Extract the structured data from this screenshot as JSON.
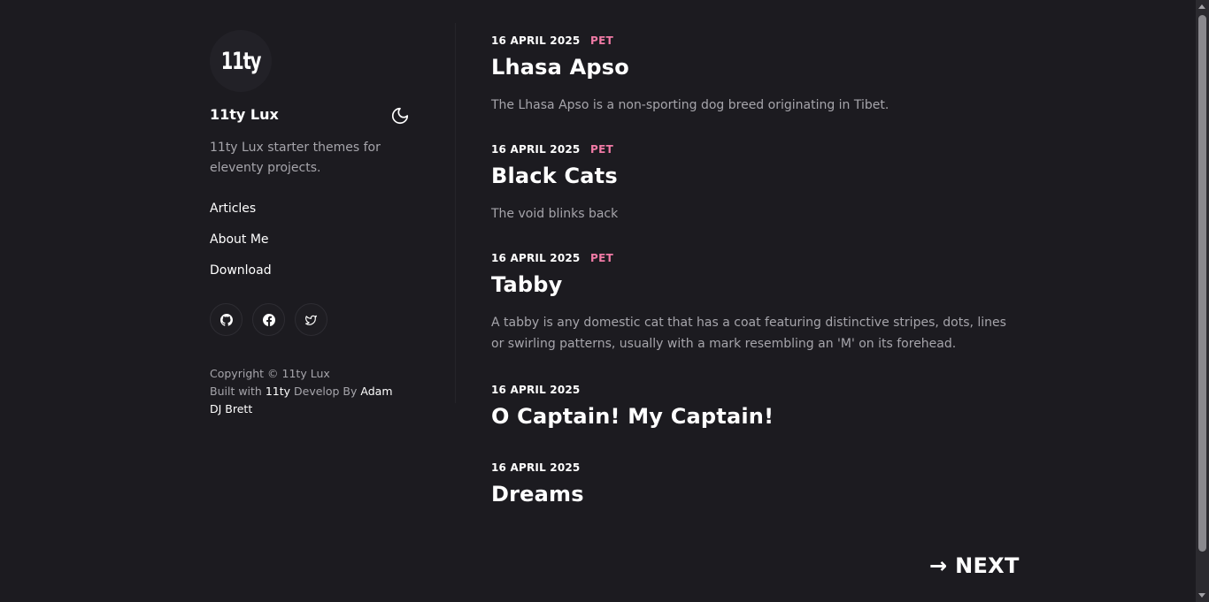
{
  "sidebar": {
    "logo_text": "11ty",
    "site_name": "11ty Lux",
    "description": "11ty Lux starter themes for eleventy projects.",
    "nav": [
      {
        "label": "Articles"
      },
      {
        "label": "About Me"
      },
      {
        "label": "Download"
      }
    ],
    "social": [
      {
        "icon": "github-icon"
      },
      {
        "icon": "facebook-icon"
      },
      {
        "icon": "twitter-icon"
      }
    ],
    "footer": {
      "copyright": "Copyright © 11ty Lux",
      "built_with_prefix": "Built with ",
      "built_with_link": "11ty",
      "develop_by_prefix": " Develop By ",
      "developer": "Adam DJ Brett"
    }
  },
  "posts": [
    {
      "date": "16 APRIL 2025",
      "tag": "PET",
      "title": "Lhasa Apso",
      "description": "The Lhasa Apso is a non-sporting dog breed originating in Tibet."
    },
    {
      "date": "16 APRIL 2025",
      "tag": "PET",
      "title": "Black Cats",
      "description": "The void blinks back"
    },
    {
      "date": "16 APRIL 2025",
      "tag": "PET",
      "title": "Tabby",
      "description": "A tabby is any domestic cat that has a coat featuring distinctive stripes, dots, lines or swirling patterns, usually with a mark resembling an 'M' on its forehead."
    },
    {
      "date": "16 APRIL 2025",
      "tag": "",
      "title": "O Captain! My Captain!",
      "description": ""
    },
    {
      "date": "16 APRIL 2025",
      "tag": "",
      "title": "Dreams",
      "description": ""
    }
  ],
  "pagination": {
    "next_label": "→ NEXT"
  },
  "colors": {
    "background": "#1c1b20",
    "tag": "#f07aa5",
    "muted_text": "#a6a5ab"
  }
}
